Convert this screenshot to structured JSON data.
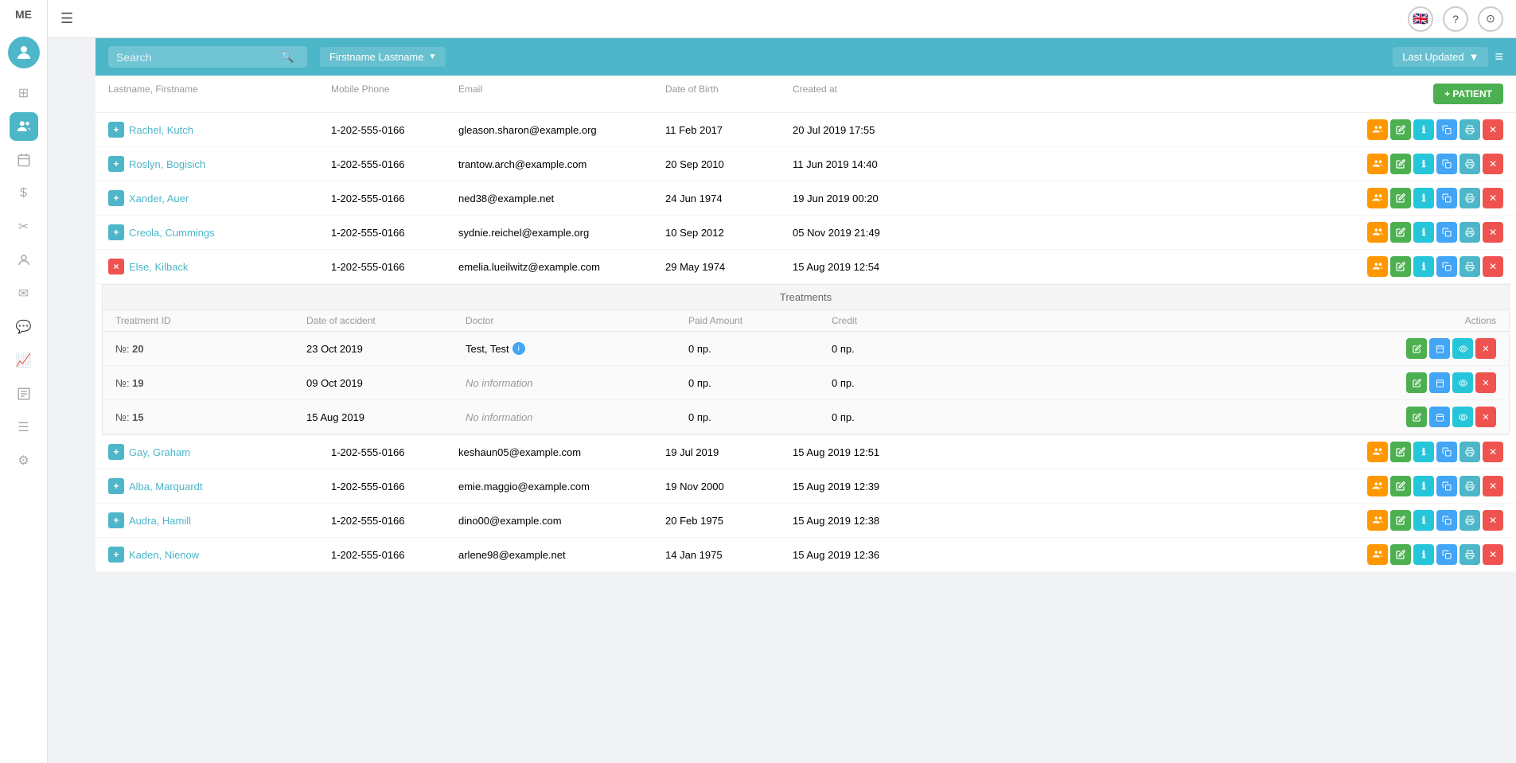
{
  "app": {
    "user_initials": "ME",
    "hamburger_label": "☰"
  },
  "topbar": {
    "flag": "🇬🇧",
    "help_label": "?",
    "user_icon": "⊙"
  },
  "search_bar": {
    "search_placeholder": "Search",
    "sort_label": "Firstname Lastname",
    "last_updated_label": "Last Updated",
    "filter_icon": "≡"
  },
  "table": {
    "columns": {
      "name": "Lastname, Firstname",
      "phone": "Mobile Phone",
      "email": "Email",
      "dob": "Date of Birth",
      "created": "Created at",
      "add_patient": "+ PATIENT"
    }
  },
  "patients": [
    {
      "id": 1,
      "expand": "plus",
      "name": "Rachel, Kutch",
      "phone": "1-202-555-0166",
      "email": "gleason.sharon@example.org",
      "dob": "11 Feb 2017",
      "created": "20 Jul 2019 17:55",
      "expanded": false
    },
    {
      "id": 2,
      "expand": "plus",
      "name": "Roslyn, Bogisich",
      "phone": "1-202-555-0166",
      "email": "trantow.arch@example.com",
      "dob": "20 Sep 2010",
      "created": "11 Jun 2019 14:40",
      "expanded": false
    },
    {
      "id": 3,
      "expand": "plus",
      "name": "Xander, Auer",
      "phone": "1-202-555-0166",
      "email": "ned38@example.net",
      "dob": "24 Jun 1974",
      "created": "19 Jun 2019 00:20",
      "expanded": false
    },
    {
      "id": 4,
      "expand": "plus",
      "name": "Creola, Cummings",
      "phone": "1-202-555-0166",
      "email": "sydnie.reichel@example.org",
      "dob": "10 Sep 2012",
      "created": "05 Nov 2019 21:49",
      "expanded": false
    },
    {
      "id": 5,
      "expand": "minus",
      "name": "Else, Kilback",
      "phone": "1-202-555-0166",
      "email": "emelia.lueilwitz@example.com",
      "dob": "29 May 1974",
      "created": "15 Aug 2019 12:54",
      "expanded": true
    }
  ],
  "treatments": {
    "title": "Treatments",
    "columns": {
      "id": "Treatment ID",
      "date": "Date of accident",
      "doctor": "Doctor",
      "paid": "Paid Amount",
      "credit": "Credit",
      "actions": "Actions"
    },
    "rows": [
      {
        "id": "20",
        "date": "23 Oct 2019",
        "doctor": "Test, Test",
        "has_info": true,
        "paid": "0 пр.",
        "credit": "0 пр."
      },
      {
        "id": "19",
        "date": "09 Oct 2019",
        "doctor": "No information",
        "has_info": false,
        "paid": "0 пр.",
        "credit": "0 пр."
      },
      {
        "id": "15",
        "date": "15 Aug 2019",
        "doctor": "No information",
        "has_info": false,
        "paid": "0 пр.",
        "credit": "0 пр."
      }
    ]
  },
  "more_patients": [
    {
      "id": 6,
      "expand": "plus",
      "name": "Gay, Graham",
      "phone": "1-202-555-0166",
      "email": "keshaun05@example.com",
      "dob": "19 Jul 2019",
      "created": "15 Aug 2019 12:51"
    },
    {
      "id": 7,
      "expand": "plus",
      "name": "Alba, Marquardt",
      "phone": "1-202-555-0166",
      "email": "emie.maggio@example.com",
      "dob": "19 Nov 2000",
      "created": "15 Aug 2019 12:39"
    },
    {
      "id": 8,
      "expand": "plus",
      "name": "Audra, Hamill",
      "phone": "1-202-555-0166",
      "email": "dino00@example.com",
      "dob": "20 Feb 1975",
      "created": "15 Aug 2019 12:38"
    },
    {
      "id": 9,
      "expand": "plus",
      "name": "Kaden, Nienow",
      "phone": "1-202-555-0166",
      "email": "arlene98@example.net",
      "dob": "14 Jan 1975",
      "created": "15 Aug 2019 12:36"
    }
  ],
  "sidebar": {
    "icons": [
      {
        "name": "dashboard-icon",
        "symbol": "⊞",
        "active": false
      },
      {
        "name": "patients-icon",
        "symbol": "👤",
        "active": true
      },
      {
        "name": "calendar-icon",
        "symbol": "📅",
        "active": false
      },
      {
        "name": "billing-icon",
        "symbol": "$",
        "active": false
      },
      {
        "name": "scissors-icon",
        "symbol": "✂",
        "active": false
      },
      {
        "name": "profile-icon",
        "symbol": "👤",
        "active": false
      },
      {
        "name": "mail-icon",
        "symbol": "✉",
        "active": false
      },
      {
        "name": "chat-icon",
        "symbol": "💬",
        "active": false
      },
      {
        "name": "analytics-icon",
        "symbol": "📈",
        "active": false
      },
      {
        "name": "reports-icon",
        "symbol": "📋",
        "active": false
      },
      {
        "name": "list-icon",
        "symbol": "☰",
        "active": false
      },
      {
        "name": "settings-icon",
        "symbol": "⚙",
        "active": false
      }
    ]
  }
}
